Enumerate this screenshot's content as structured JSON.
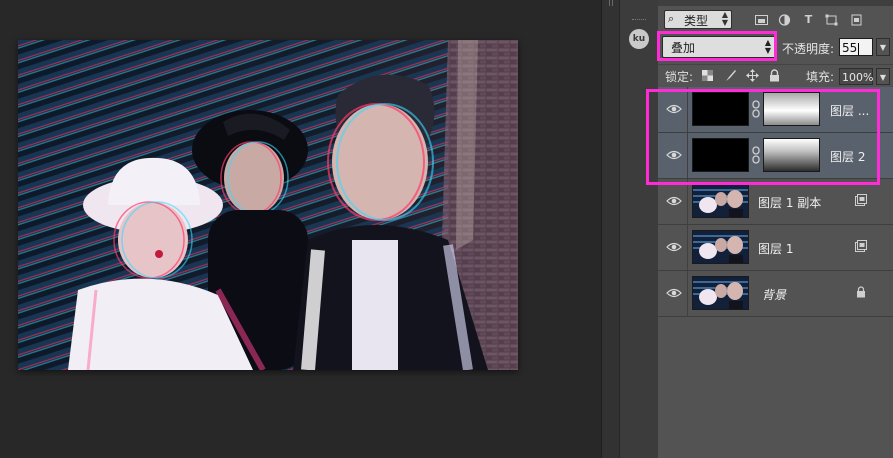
{
  "canvas": {
    "image_alt": "Three young people posing with a glitch RGB-split effect"
  },
  "sidebar": {
    "badge": "ku"
  },
  "layers_panel": {
    "filter_kind": {
      "label": "类型",
      "icons": [
        "image-filter-icon",
        "adjustment-filter-icon",
        "type-filter-icon",
        "shape-filter-icon",
        "smart-object-filter-icon"
      ]
    },
    "blend_mode": {
      "value": "叠加"
    },
    "opacity": {
      "label": "不透明度:",
      "value": "55"
    },
    "lock": {
      "label": "锁定:",
      "icons": [
        "lock-transparent-icon",
        "lock-paint-icon",
        "lock-move-icon",
        "lock-all-icon"
      ]
    },
    "fill": {
      "label": "填充:",
      "value": "100%"
    },
    "layers": [
      {
        "name": "图层 ...",
        "type": "gradient-mask",
        "selected": true,
        "thumb": "black",
        "mask": "grad1"
      },
      {
        "name": "图层 2",
        "type": "gradient-mask",
        "selected": true,
        "thumb": "black",
        "mask": "grad2"
      },
      {
        "name": "图层 1 副本",
        "type": "smart-object",
        "selected": false,
        "thumb": "photo"
      },
      {
        "name": "图层 1",
        "type": "smart-object",
        "selected": false,
        "thumb": "photo"
      },
      {
        "name": "背景",
        "type": "background",
        "selected": false,
        "thumb": "photo",
        "locked": true
      }
    ]
  },
  "colors": {
    "highlight": "#ff2bd6",
    "panel": "#535353",
    "selected_row": "#59616d",
    "workspace": "#282828"
  }
}
